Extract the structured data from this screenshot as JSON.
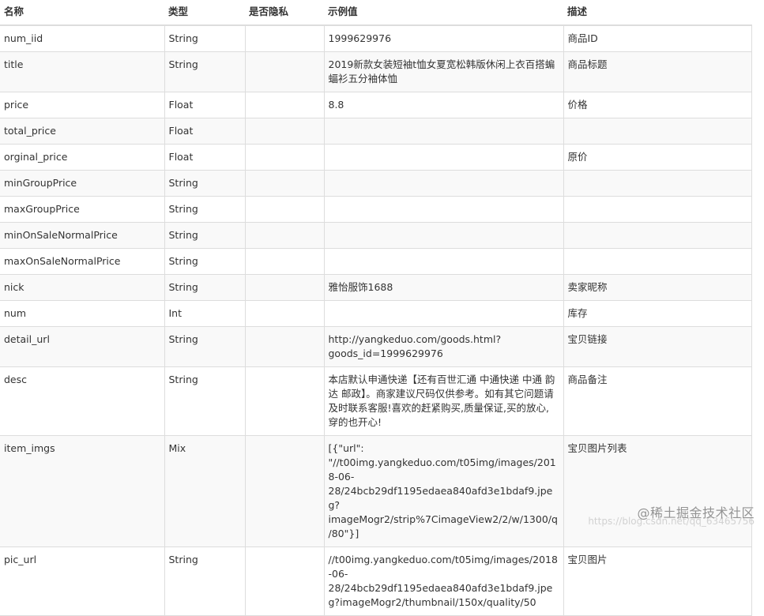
{
  "headers": [
    "名称",
    "类型",
    "是否隐私",
    "示例值",
    "描述"
  ],
  "rows": [
    {
      "name": "num_iid",
      "type": "String",
      "privacy": "",
      "example": "1999629976",
      "desc": "商品ID"
    },
    {
      "name": "title",
      "type": "String",
      "privacy": "",
      "example": "2019新款女装短袖t恤女夏宽松韩版休闲上衣百搭蝙蝠衫五分袖体恤",
      "desc": "商品标题"
    },
    {
      "name": "price",
      "type": "Float",
      "privacy": "",
      "example": "8.8",
      "desc": "价格"
    },
    {
      "name": "total_price",
      "type": "Float",
      "privacy": "",
      "example": "",
      "desc": ""
    },
    {
      "name": "orginal_price",
      "type": "Float",
      "privacy": "",
      "example": "",
      "desc": "原价"
    },
    {
      "name": "minGroupPrice",
      "type": "String",
      "privacy": "",
      "example": "",
      "desc": ""
    },
    {
      "name": "maxGroupPrice",
      "type": "String",
      "privacy": "",
      "example": "",
      "desc": ""
    },
    {
      "name": "minOnSaleNormalPrice",
      "type": "String",
      "privacy": "",
      "example": "",
      "desc": ""
    },
    {
      "name": "maxOnSaleNormalPrice",
      "type": "String",
      "privacy": "",
      "example": "",
      "desc": ""
    },
    {
      "name": "nick",
      "type": "String",
      "privacy": "",
      "example": "雅怡服饰1688",
      "desc": "卖家昵称"
    },
    {
      "name": "num",
      "type": "Int",
      "privacy": "",
      "example": "",
      "desc": "库存"
    },
    {
      "name": "detail_url",
      "type": "String",
      "privacy": "",
      "example": "http://yangkeduo.com/goods.html?goods_id=1999629976",
      "desc": "宝贝链接"
    },
    {
      "name": "desc",
      "type": "String",
      "privacy": "",
      "example": "本店默认申通快递【还有百世汇通 中通快递 中通 韵达 邮政】。商家建议尺码仅供参考。如有其它问题请及时联系客服!喜欢的赶紧购买,质量保证,买的放心,穿的也开心!",
      "desc": "商品备注"
    },
    {
      "name": "item_imgs",
      "type": "Mix",
      "privacy": "",
      "example": "[{\"url\": \"//t00img.yangkeduo.com/t05img/images/2018-06-28/24bcb29df1195edaea840afd3e1bdaf9.jpeg?imageMogr2/strip%7CimageView2/2/w/1300/q/80\"}]",
      "desc": "宝贝图片列表"
    },
    {
      "name": "pic_url",
      "type": "String",
      "privacy": "",
      "example": "//t00img.yangkeduo.com/t05img/images/2018-06-28/24bcb29df1195edaea840afd3e1bdaf9.jpeg?imageMogr2/thumbnail/150x/quality/50",
      "desc": "宝贝图片"
    }
  ],
  "watermark": "@稀土掘金技术社区",
  "watermark_url": "https://blog.csdn.net/qq_63465756"
}
